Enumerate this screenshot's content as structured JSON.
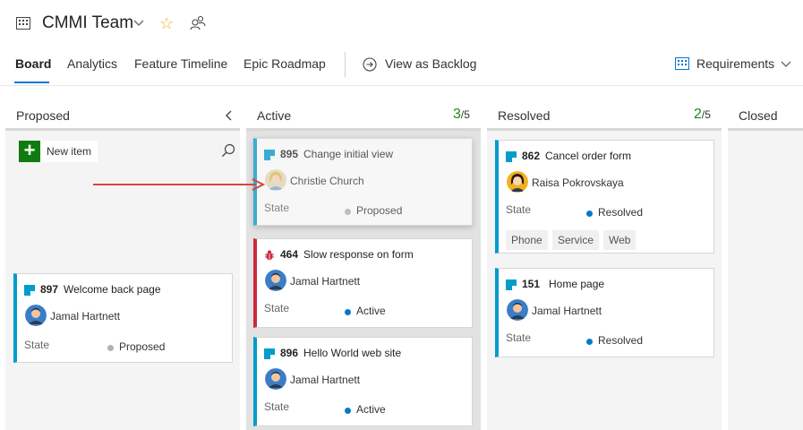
{
  "header": {
    "team_name": "CMMI Team"
  },
  "tabs": {
    "board": "Board",
    "analytics": "Analytics",
    "feature_timeline": "Feature Timeline",
    "epic_roadmap": "Epic Roadmap",
    "view_as_backlog": "View as Backlog",
    "requirements": "Requirements"
  },
  "columns": {
    "proposed": {
      "title": "Proposed",
      "new_item": "New item"
    },
    "active": {
      "title": "Active",
      "count": "3",
      "limit": "/5"
    },
    "resolved": {
      "title": "Resolved",
      "count": "2",
      "limit": "/5"
    },
    "closed": {
      "title": "Closed"
    }
  },
  "cards": {
    "c897": {
      "id": "897",
      "title": "Welcome back page",
      "assignee": "Jamal Hartnett",
      "state_label": "State",
      "state": "Proposed"
    },
    "c895": {
      "id": "895",
      "title": "Change initial view",
      "assignee": "Christie Church",
      "state_label": "State",
      "state": "Proposed"
    },
    "c464": {
      "id": "464",
      "title": "Slow response on form",
      "assignee": "Jamal Hartnett",
      "state_label": "State",
      "state": "Active"
    },
    "c896": {
      "id": "896",
      "title": "Hello World web site",
      "assignee": "Jamal Hartnett",
      "state_label": "State",
      "state": "Active"
    },
    "c862": {
      "id": "862",
      "title": "Cancel order form",
      "assignee": "Raisa Pokrovskaya",
      "state_label": "State",
      "state": "Resolved",
      "tags": [
        "Phone",
        "Service",
        "Web"
      ]
    },
    "c151": {
      "id": "151",
      "title": "Home page",
      "assignee": "Jamal Hartnett",
      "state_label": "State",
      "state": "Resolved"
    }
  },
  "colors": {
    "accent": "#0078d4",
    "story": "#009ccc",
    "bug": "#cc293d",
    "proposed_dot": "#b2b2b2",
    "active_dot": "#007acc",
    "resolved_dot": "#007acc",
    "arrow": "#d9453a"
  }
}
